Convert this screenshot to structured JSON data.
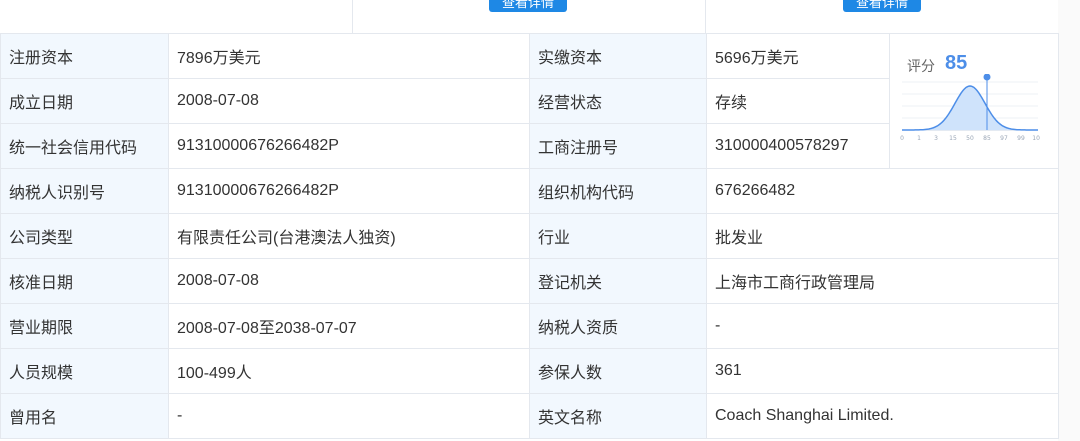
{
  "top": {
    "button_label": "查看详情"
  },
  "score": {
    "label": "评分",
    "value": "85",
    "ticks": [
      "0",
      "1",
      "3",
      "15",
      "50",
      "85",
      "97",
      "99",
      "100"
    ],
    "colors": {
      "accent": "#4d8ee8",
      "curve_fill": "#cfe3fb"
    }
  },
  "rows": [
    {
      "l1": "注册资本",
      "v1": "7896万美元",
      "l2": "实缴资本",
      "v2": "5696万美元"
    },
    {
      "l1": "成立日期",
      "v1": "2008-07-08",
      "l2": "经营状态",
      "v2": "存续"
    },
    {
      "l1": "统一社会信用代码",
      "v1": "91310000676266482P",
      "l2": "工商注册号",
      "v2": "310000400578297"
    },
    {
      "l1": "纳税人识别号",
      "v1": "91310000676266482P",
      "l2": "组织机构代码",
      "v2": "676266482"
    },
    {
      "l1": "公司类型",
      "v1": "有限责任公司(台港澳法人独资)",
      "l2": "行业",
      "v2": "批发业"
    },
    {
      "l1": "核准日期",
      "v1": "2008-07-08",
      "l2": "登记机关",
      "v2": "上海市工商行政管理局"
    },
    {
      "l1": "营业期限",
      "v1": "2008-07-08至2038-07-07",
      "l2": "纳税人资质",
      "v2": "-"
    },
    {
      "l1": "人员规模",
      "v1": "100-499人",
      "l2": "参保人数",
      "v2": "361"
    },
    {
      "l1": "曾用名",
      "v1": "-",
      "l2": "英文名称",
      "v2": "Coach Shanghai Limited."
    }
  ]
}
